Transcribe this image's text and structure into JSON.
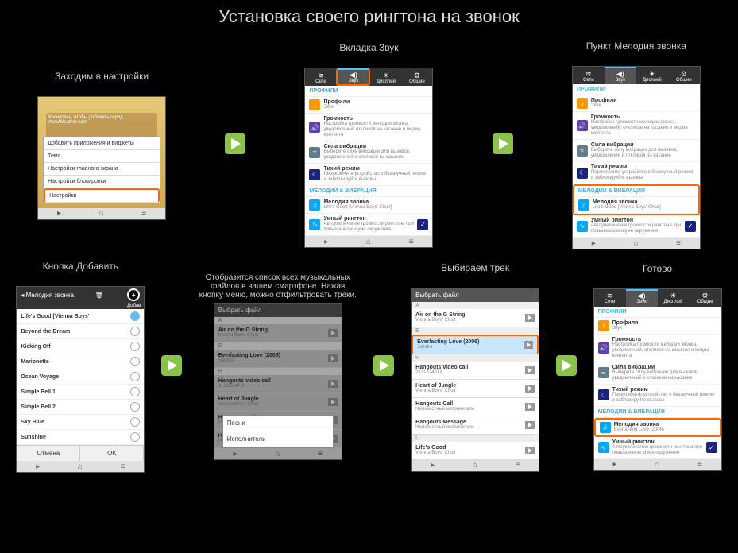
{
  "page_title": "Установка своего рингтона на звонок",
  "tabs": {
    "net": "Сети",
    "sound": "Звук",
    "disp": "Дисплей",
    "gen": "Общие"
  },
  "sections": {
    "profiles": "ПРОФИЛИ",
    "melody": "МЕЛОДИИ & ВИБРАЦИЯ"
  },
  "sound_items": {
    "prof": {
      "t": "Профили",
      "s": "Звук"
    },
    "vol": {
      "t": "Громкость",
      "s": "Настройка громкости мелодии звонка, уведомлений, откликов на касание и медиа контента"
    },
    "vib": {
      "t": "Сила вибрации",
      "s": "Выберите силу вибрации для вызовов, уведомлений и откликов на касание"
    },
    "quiet": {
      "t": "Тихий режим",
      "s": "Переключите устройство в беззвучный режим и заблокируйте вызовы"
    },
    "ring": {
      "t": "Мелодия звонка",
      "s": "Life's Good [Vienna Boys' Choir]"
    },
    "ring2": {
      "t": "Мелодия звонка",
      "s": "Everlasting Love (2006)"
    },
    "smart": {
      "t": "Умный рингтон",
      "s": "Автоувеличение громкости рингтона при повышенном шуме окружения"
    }
  },
  "captions": {
    "c1": "Заходим в настройки",
    "c2": "Вкладка Звук",
    "c3": "Пункт Мелодия звонка",
    "c4": "Кнопка Добавить",
    "c5": "Отобразится список всех музыкальных файлов в вашем смартфоне. Нажав кнопку меню, можно отфильтровать треки.",
    "c6": "Выбираем трек",
    "c7": "Готово"
  },
  "ctx": {
    "add": "Добавить приложения и виджеты",
    "theme": "Тема",
    "home": "Настройки главного экрана",
    "lock": "Настройки блокировки",
    "settings": "Настройки"
  },
  "ringtone_header": "Мелодия звонка",
  "add_label": "Добав",
  "tones": [
    "Life's Good [Vienna Boys' ",
    "Beyond the Dream",
    "Kicking Off",
    "Marionette",
    "Ocean Voyage",
    "Simple Bell 1",
    "Simple Bell 2",
    "Sky Blue",
    "Sunshine"
  ],
  "btns": {
    "cancel": "Отмена",
    "ok": "OK"
  },
  "file_header": "Выбрать файл",
  "files": {
    "air": {
      "t": "Air on the G String",
      "s": "Vienna Boys' Choir"
    },
    "ever": {
      "t": "Everlasting Love (2006)",
      "s": "Sandra"
    },
    "hang": {
      "t": "Hangouts video call",
      "s": "2131624071"
    },
    "heart": {
      "t": "Heart of Jungle",
      "s": "Vienna Boys' Choir"
    },
    "hcall": {
      "t": "Hangouts Call",
      "s": "Неизвестный исполнитель"
    },
    "hmsg": {
      "t": "Hangouts Message",
      "s": "Неизвестный исполнитель"
    },
    "life": {
      "t": "Life's Good",
      "s": "Vienna Boys' Choir"
    }
  },
  "letters": {
    "a": "A",
    "e": "E",
    "h": "H",
    "l": "L"
  },
  "popup": {
    "songs": "Песни",
    "artists": "Исполнители"
  }
}
